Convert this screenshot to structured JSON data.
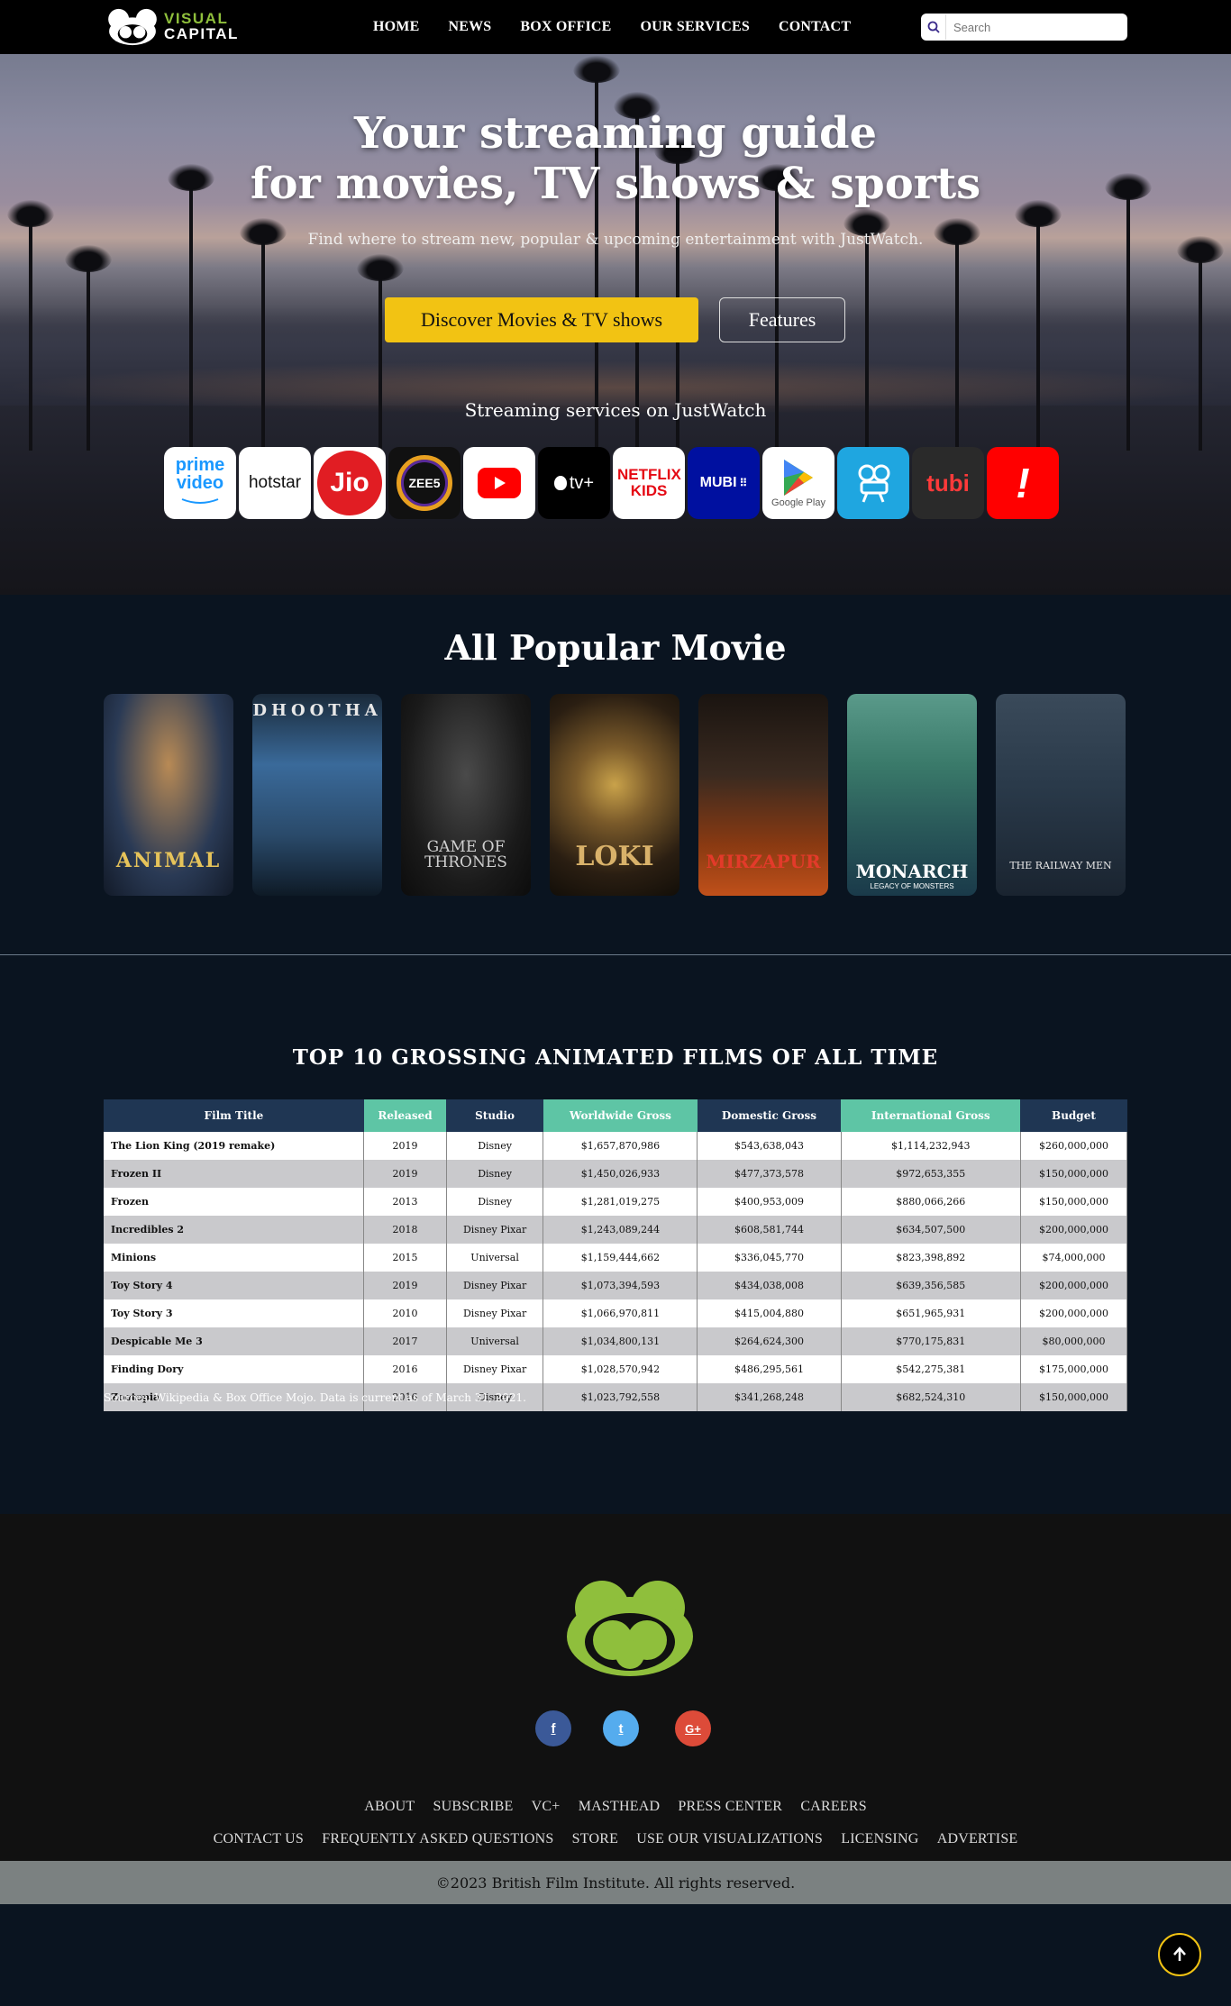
{
  "nav": {
    "logo_line1": "VISUAL",
    "logo_line2": "CAPITAL",
    "items": [
      "HOME",
      "NEWS",
      "BOX OFFICE",
      "OUR SERVICES",
      "CONTACT"
    ],
    "search_placeholder": "Search"
  },
  "hero": {
    "title_line1": "Your streaming guide",
    "title_line2": "for movies, TV shows & sports",
    "subtitle": "Find where to stream new, popular & upcoming entertainment with JustWatch.",
    "primary_button": "Discover Movies & TV shows",
    "secondary_button": "Features",
    "services_label": "Streaming services on JustWatch",
    "providers": [
      {
        "name": "prime video",
        "bg": "#ffffff",
        "fg": "#1a98ff"
      },
      {
        "name": "hotstar",
        "bg": "#ffffff",
        "fg": "#111111"
      },
      {
        "name": "Jio",
        "bg": "#e11d23",
        "fg": "#ffffff"
      },
      {
        "name": "ZEE5",
        "bg": "#111111",
        "fg": "#ffffff"
      },
      {
        "name": "YouTube",
        "bg": "#ffffff",
        "fg": "#ff0000"
      },
      {
        "name": "tv+",
        "bg": "#000000",
        "fg": "#ffffff"
      },
      {
        "name": "NETFLIX KIDS",
        "bg": "#ffffff",
        "fg": "#e50914"
      },
      {
        "name": "MUBI",
        "bg": "#0010a0",
        "fg": "#ffffff"
      },
      {
        "name": "Google Play",
        "bg": "#ffffff",
        "fg": "#555555"
      },
      {
        "name": "Hoichoi",
        "bg": "#1fa6e0",
        "fg": "#ffffff"
      },
      {
        "name": "tubi",
        "bg": "#2a2a2a",
        "fg": "#ff3a3a"
      },
      {
        "name": "!",
        "bg": "#ff0000",
        "fg": "#ffffff"
      }
    ]
  },
  "popular": {
    "heading": "All Popular Movie",
    "posters": [
      {
        "title": "ANIMAL",
        "c1": "#2a3a55",
        "c2": "#8a6a3a",
        "fg": "#e6c35a"
      },
      {
        "title": "DHOOTHA",
        "c1": "#3a5a7a",
        "c2": "#1a2a3a",
        "fg": "#e8e8e8"
      },
      {
        "title": "GAME OF THRONES",
        "c1": "#2a2a2a",
        "c2": "#111111",
        "fg": "#cfcfcf"
      },
      {
        "title": "LOKI",
        "c1": "#3a2a1a",
        "c2": "#8a6a2a",
        "fg": "#d9b26a"
      },
      {
        "title": "MIRZAPUR",
        "c1": "#2a1a10",
        "c2": "#b04010",
        "fg": "#e33a2a"
      },
      {
        "title": "MONARCH",
        "c1": "#3a7a6a",
        "c2": "#1a3a4a",
        "fg": "#ffffff",
        "subtitle": "LEGACY OF MONSTERS"
      },
      {
        "title": "THE RAILWAY MEN",
        "c1": "#2a3a4a",
        "c2": "#1a2430",
        "fg": "#e8e8e8"
      }
    ]
  },
  "gross": {
    "heading": "TOP 10 GROSSING ANIMATED FILMS OF ALL TIME",
    "columns": [
      "Film Title",
      "Released",
      "Studio",
      "Worldwide Gross",
      "Domestic Gross",
      "International Gross",
      "Budget"
    ],
    "rows": [
      [
        "The Lion King (2019 remake)",
        "2019",
        "Disney",
        "$1,657,870,986",
        "$543,638,043",
        "$1,114,232,943",
        "$260,000,000"
      ],
      [
        "Frozen II",
        "2019",
        "Disney",
        "$1,450,026,933",
        "$477,373,578",
        "$972,653,355",
        "$150,000,000"
      ],
      [
        "Frozen",
        "2013",
        "Disney",
        "$1,281,019,275",
        "$400,953,009",
        "$880,066,266",
        "$150,000,000"
      ],
      [
        "Incredibles 2",
        "2018",
        "Disney Pixar",
        "$1,243,089,244",
        "$608,581,744",
        "$634,507,500",
        "$200,000,000"
      ],
      [
        "Minions",
        "2015",
        "Universal",
        "$1,159,444,662",
        "$336,045,770",
        "$823,398,892",
        "$74,000,000"
      ],
      [
        "Toy Story 4",
        "2019",
        "Disney Pixar",
        "$1,073,394,593",
        "$434,038,008",
        "$639,356,585",
        "$200,000,000"
      ],
      [
        "Toy Story 3",
        "2010",
        "Disney Pixar",
        "$1,066,970,811",
        "$415,004,880",
        "$651,965,931",
        "$200,000,000"
      ],
      [
        "Despicable Me 3",
        "2017",
        "Universal",
        "$1,034,800,131",
        "$264,624,300",
        "$770,175,831",
        "$80,000,000"
      ],
      [
        "Finding Dory",
        "2016",
        "Disney Pixar",
        "$1,028,570,942",
        "$486,295,561",
        "$542,275,381",
        "$175,000,000"
      ],
      [
        "Zootopia",
        "2016",
        "Disney",
        "$1,023,792,558",
        "$341,268,248",
        "$682,524,310",
        "$150,000,000"
      ]
    ],
    "sources": "Sources: Wikipedia & Box Office Mojo. Data is current as of March 31, 2021."
  },
  "footer": {
    "social": [
      {
        "label": "f",
        "name": "facebook",
        "color": "#3b5998"
      },
      {
        "label": "t",
        "name": "twitter",
        "color": "#55acee"
      },
      {
        "label": "G+",
        "name": "google-plus",
        "color": "#dd4b39"
      }
    ],
    "links_row1": [
      "ABOUT",
      "SUBSCRIBE",
      "VC+",
      "MASTHEAD",
      "PRESS CENTER",
      "CAREERS"
    ],
    "links_row2": [
      "CONTACT US",
      "FREQUENTLY ASKED QUESTIONS",
      "STORE",
      "USE OUR VISUALIZATIONS",
      "LICENSING",
      "ADVERTISE"
    ],
    "copyright": "©2023 British Film Institute. All rights reserved."
  },
  "colors": {
    "accent": "#f2c313",
    "header_navy": "#1f3653",
    "header_teal": "#5ec5a5",
    "brand_green": "#8fbf3c"
  }
}
